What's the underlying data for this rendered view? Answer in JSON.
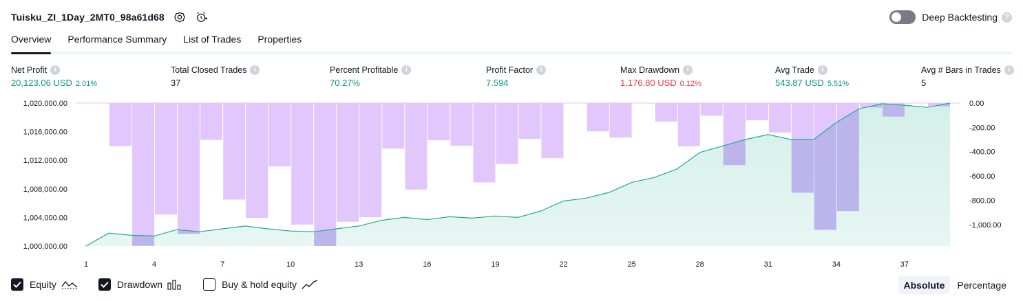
{
  "header": {
    "title": "Tuisku_ZI_1Day_2MT0_98a61d68",
    "deep_backtesting_label": "Deep Backtesting",
    "help_glyph": "?"
  },
  "tabs": [
    "Overview",
    "Performance Summary",
    "List of Trades",
    "Properties"
  ],
  "metrics": {
    "net_profit": {
      "label": "Net Profit",
      "value": "20,123.06 USD",
      "pct": "2.01%"
    },
    "total_closed_trades": {
      "label": "Total Closed Trades",
      "value": "37"
    },
    "percent_profitable": {
      "label": "Percent Profitable",
      "value": "70.27%"
    },
    "profit_factor": {
      "label": "Profit Factor",
      "value": "7.594"
    },
    "max_drawdown": {
      "label": "Max Drawdown",
      "value": "1,176.80 USD",
      "pct": "0.12%"
    },
    "avg_trade": {
      "label": "Avg Trade",
      "value": "543.87 USD",
      "pct": "5.51%"
    },
    "avg_bars": {
      "label": "Avg # Bars in Trades",
      "value": "5"
    }
  },
  "legend": {
    "equity": {
      "label": "Equity",
      "checked": true
    },
    "drawdown": {
      "label": "Drawdown",
      "checked": true
    },
    "buy_hold": {
      "label": "Buy & hold equity",
      "checked": false
    }
  },
  "mode": {
    "absolute": "Absolute",
    "percentage": "Percentage",
    "selected": "Absolute"
  },
  "colors": {
    "equity_line": "#22ab94",
    "equity_fill": "#d4efe9",
    "drawdown_bar": "#e1c7fb",
    "drawdown_overlap": "#bbb5eb",
    "positive": "#089981",
    "negative": "#f23645"
  },
  "chart_data": {
    "type": "area",
    "series": [
      {
        "name": "Equity",
        "type": "area",
        "axis": "left",
        "values": [
          1000000,
          1001800,
          1001500,
          1001400,
          1002300,
          1002000,
          1002400,
          1002800,
          1002400,
          1002100,
          1002000,
          1002400,
          1002800,
          1003600,
          1004000,
          1003700,
          1004100,
          1003900,
          1004200,
          1004000,
          1004900,
          1006300,
          1006700,
          1007500,
          1008900,
          1009600,
          1010800,
          1013100,
          1014000,
          1014900,
          1015600,
          1014900,
          1014900,
          1017300,
          1019200,
          1019900,
          1019700,
          1019400,
          1020000
        ]
      },
      {
        "name": "Drawdown",
        "type": "bar",
        "axis": "right",
        "values": [
          0,
          -355,
          -1175,
          -918,
          -1076,
          -303,
          -795,
          -945,
          -521,
          -1000,
          -1176,
          -977,
          -940,
          -375,
          -712,
          -306,
          -351,
          -653,
          -501,
          -294,
          -454,
          0,
          -233,
          -284,
          0,
          -152,
          -356,
          -104,
          -510,
          -141,
          -242,
          -738,
          -1044,
          -889,
          -36,
          -111,
          -3,
          -25
        ]
      }
    ],
    "x_ticks": [
      1,
      4,
      7,
      10,
      13,
      16,
      19,
      22,
      25,
      28,
      31,
      34,
      37
    ],
    "y_left_ticks": [
      "1,000,000.00",
      "1,004,000.00",
      "1,008,000.00",
      "1,012,000.00",
      "1,016,000.00",
      "1,020,000.00"
    ],
    "y_right_ticks": [
      "0.00",
      "-200.00",
      "-400.00",
      "-600.00",
      "-800.00",
      "-1,000.00"
    ],
    "y_left_range": [
      1000000,
      1020000
    ],
    "y_right_range": [
      -1176.8,
      0
    ],
    "grid": false
  }
}
